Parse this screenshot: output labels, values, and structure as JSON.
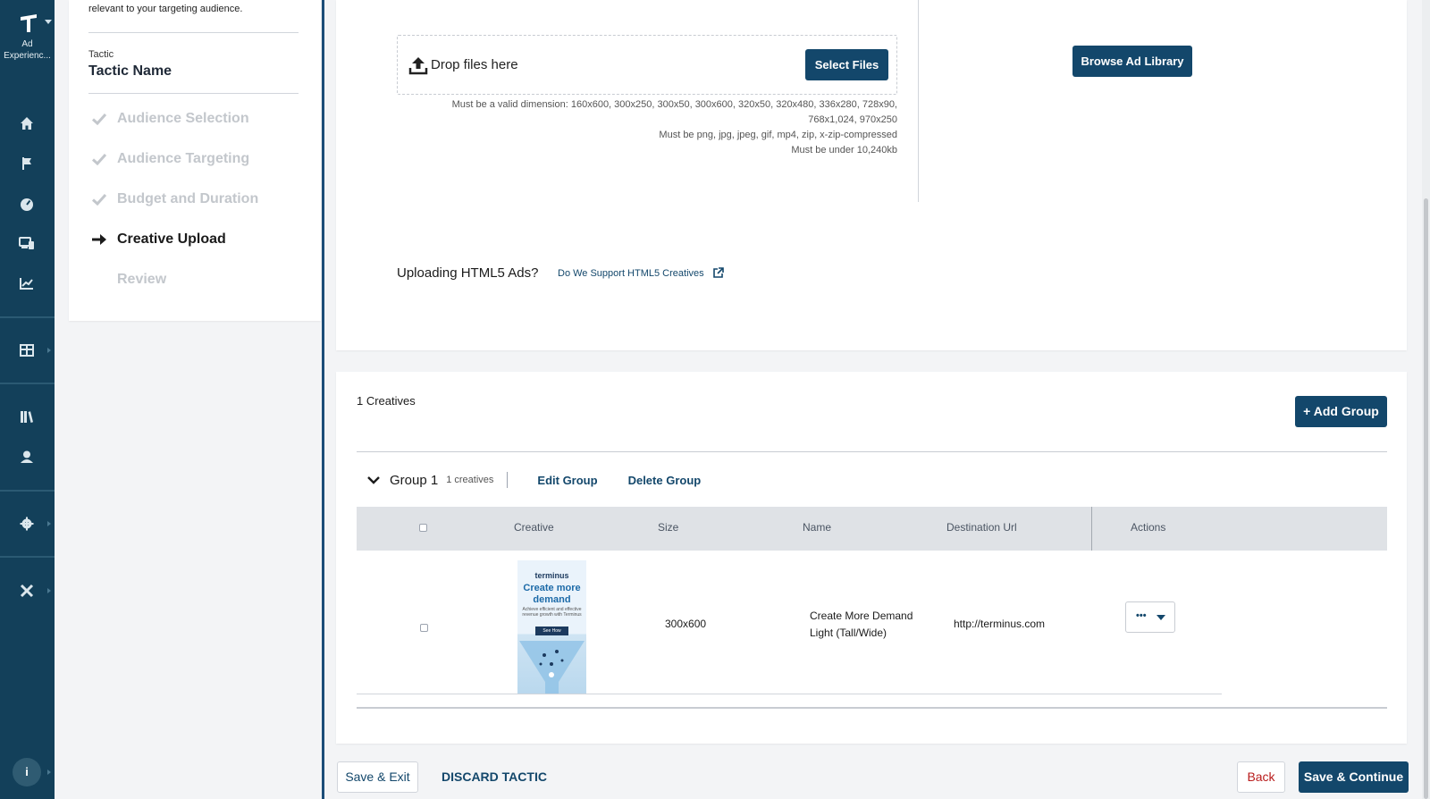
{
  "nav": {
    "app_name_line1": "Ad",
    "app_name_line2": "Experienc...",
    "icons": [
      "home-icon",
      "flag-icon",
      "dashboard-icon",
      "devices-icon",
      "analytics-icon",
      "table-icon",
      "library-icon",
      "user-icon",
      "settings-icon",
      "tools-icon"
    ],
    "info_label": "i"
  },
  "stepper": {
    "intro_text": "relevant to your targeting audience.",
    "tactic_label": "Tactic",
    "tactic_name": "Tactic Name",
    "steps": [
      {
        "label": "Audience Selection",
        "state": "done"
      },
      {
        "label": "Audience Targeting",
        "state": "done"
      },
      {
        "label": "Budget and Duration",
        "state": "done"
      },
      {
        "label": "Creative Upload",
        "state": "active"
      },
      {
        "label": "Review",
        "state": "pending"
      }
    ]
  },
  "upload": {
    "drop_text": "Drop files here",
    "select_files": "Select Files",
    "requirements": {
      "dimensions_line1": "Must be a valid dimension: 160x600, 300x250, 300x50, 300x600, 320x50, 320x480, 336x280, 728x90,",
      "dimensions_line2": "768x1,024, 970x250",
      "formats": "Must be png, jpg, jpeg, gif, mp4, zip, x-zip-compressed",
      "size": "Must be under 10,240kb"
    },
    "browse_library": "Browse Ad Library",
    "html5_question": "Uploading HTML5 Ads?",
    "html5_link": "Do We Support HTML5 Creatives"
  },
  "creatives": {
    "count_label": "1 Creatives",
    "add_group": "Add Group",
    "group": {
      "name": "Group 1",
      "count": "1 creatives",
      "edit": "Edit Group",
      "delete": "Delete Group"
    },
    "columns": [
      "Creative",
      "Size",
      "Name",
      "Destination Url",
      "Actions"
    ],
    "rows": [
      {
        "thumbnail": {
          "brand": "terminus",
          "headline_line1": "Create more",
          "headline_line2": "demand",
          "subtext": "Achieve efficient and effective revenue growth with Terminus",
          "cta": "See How"
        },
        "size": "300x600",
        "name_line1": "Create More Demand",
        "name_line2": "Light (Tall/Wide)",
        "destination_url": "http://terminus.com",
        "actions_label": "•••"
      }
    ]
  },
  "footer": {
    "save_exit": "Save & Exit",
    "discard": "DISCARD TACTIC",
    "back": "Back",
    "save_continue": "Save & Continue"
  },
  "colors": {
    "rail": "#13405a",
    "primary": "#13476b",
    "danger": "#b91c1c"
  }
}
